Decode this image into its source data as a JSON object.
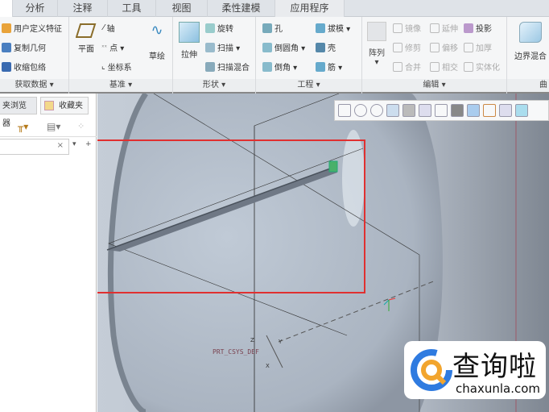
{
  "tabs": [
    "分析",
    "注释",
    "工具",
    "视图",
    "柔性建模",
    "应用程序"
  ],
  "groups": {
    "get_data": {
      "label": "获取数据 ▾",
      "items": [
        "用户定义特征",
        "复制几何",
        "收缩包络"
      ]
    },
    "datum": {
      "label": "基准 ▾",
      "plane": "平面",
      "axis": "轴",
      "point": "点 ▾",
      "csys": "坐标系",
      "sketch": "草绘"
    },
    "shape": {
      "label": "形状 ▾",
      "extrude": "拉伸",
      "revolve": "旋转",
      "sweep": "扫描 ▾",
      "swept_blend": "扫描混合"
    },
    "engineering": {
      "label": "工程 ▾",
      "hole": "孔",
      "round": "倒圆角 ▾",
      "chamfer": "倒角 ▾",
      "draft": "拔模 ▾",
      "shell": "壳",
      "rib": "筋 ▾"
    },
    "editing": {
      "label": "编辑 ▾",
      "pattern": "阵列",
      "pattern_arrow": "▾",
      "mirror": "镜像",
      "extend": "延伸",
      "project": "投影",
      "trim": "修剪",
      "offset": "偏移",
      "thicken": "加厚",
      "merge": "合并",
      "intersect": "相交",
      "solidify": "实体化"
    },
    "surfaces": {
      "label": "曲",
      "boundary_blend": "边界混合"
    }
  },
  "left_panel": {
    "tab_browser": "夹浏览器",
    "tab_favorites": "收藏夹",
    "search_clear": "×",
    "search_value": ""
  },
  "viewport": {
    "csys_label": "PRT_CSYS_DEF",
    "axis_z": "Z",
    "axis_y": "Y",
    "axis_x": "X"
  },
  "watermark": {
    "name": "查询啦",
    "url": "chaxunla.com"
  },
  "colors": {
    "highlight": "#e03030",
    "accent": "#2f7be0"
  }
}
